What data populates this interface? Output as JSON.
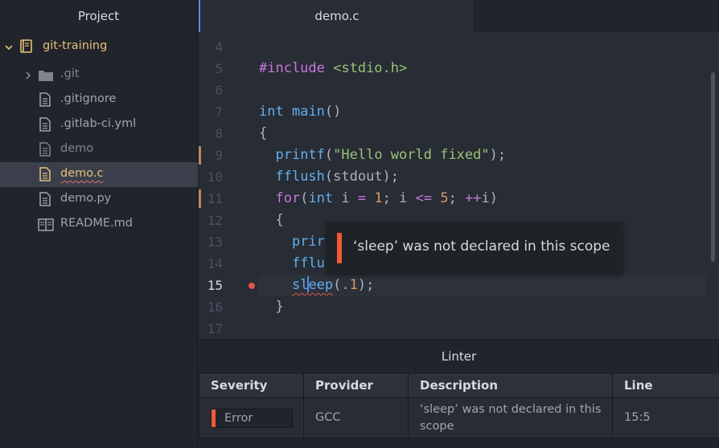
{
  "sidebar": {
    "title": "Project",
    "root": {
      "label": "git-training",
      "icon": "repo-icon"
    },
    "items": [
      {
        "label": ".git",
        "icon": "folder-icon",
        "type": "folder",
        "state": "ignored"
      },
      {
        "label": ".gitignore",
        "icon": "file-icon",
        "type": "file",
        "state": "normal"
      },
      {
        "label": ".gitlab-ci.yml",
        "icon": "file-icon",
        "type": "file",
        "state": "normal"
      },
      {
        "label": "demo",
        "icon": "file-icon",
        "type": "file",
        "state": "ignored"
      },
      {
        "label": "demo.c",
        "icon": "file-icon",
        "type": "file",
        "state": "selected"
      },
      {
        "label": "demo.py",
        "icon": "file-icon",
        "type": "file",
        "state": "normal"
      },
      {
        "label": "README.md",
        "icon": "book-icon",
        "type": "file",
        "state": "normal"
      }
    ]
  },
  "editor": {
    "tab_title": "demo.c",
    "lines": [
      {
        "num": "4",
        "tokens": []
      },
      {
        "num": "5",
        "tokens": [
          [
            "inc",
            "#include "
          ],
          [
            "str",
            "<stdio.h>"
          ]
        ]
      },
      {
        "num": "6",
        "tokens": []
      },
      {
        "num": "7",
        "tokens": [
          [
            "ty",
            "int"
          ],
          [
            "pl",
            " "
          ],
          [
            "fn",
            "main"
          ],
          [
            "pl",
            "()"
          ]
        ]
      },
      {
        "num": "8",
        "tokens": [
          [
            "pl",
            "{"
          ]
        ]
      },
      {
        "num": "9",
        "git": true,
        "tokens": [
          [
            "pl",
            "  "
          ],
          [
            "fn",
            "printf"
          ],
          [
            "pl",
            "("
          ],
          [
            "str",
            "\"Hello world fixed\""
          ],
          [
            "pl",
            ");"
          ]
        ]
      },
      {
        "num": "10",
        "tokens": [
          [
            "pl",
            "  "
          ],
          [
            "fn",
            "fflush"
          ],
          [
            "pl",
            "(stdout);"
          ]
        ]
      },
      {
        "num": "11",
        "git": true,
        "tokens": [
          [
            "pl",
            "  "
          ],
          [
            "kw",
            "for"
          ],
          [
            "pl",
            "("
          ],
          [
            "ty",
            "int"
          ],
          [
            "pl",
            " i "
          ],
          [
            "op",
            "="
          ],
          [
            "pl",
            " "
          ],
          [
            "num",
            "1"
          ],
          [
            "pl",
            "; i "
          ],
          [
            "op",
            "<="
          ],
          [
            "pl",
            " "
          ],
          [
            "num",
            "5"
          ],
          [
            "pl",
            "; "
          ],
          [
            "op",
            "++"
          ],
          [
            "pl",
            "i)"
          ]
        ]
      },
      {
        "num": "12",
        "tokens": [
          [
            "pl",
            "  {"
          ]
        ]
      },
      {
        "num": "13",
        "tokens": [
          [
            "pl",
            "    "
          ],
          [
            "fn",
            "prir"
          ]
        ]
      },
      {
        "num": "14",
        "tokens": [
          [
            "pl",
            "    "
          ],
          [
            "fn",
            "fflu"
          ]
        ]
      },
      {
        "num": "15",
        "active": true,
        "error": true,
        "tokens": [
          [
            "pl",
            "    "
          ],
          [
            "fn",
            "sl"
          ],
          [
            "caret",
            ""
          ],
          [
            "fnerr",
            "eep"
          ],
          [
            "pl",
            "("
          ],
          [
            "num",
            ".1"
          ],
          [
            "pl",
            ");"
          ]
        ]
      },
      {
        "num": "16",
        "tokens": [
          [
            "pl",
            "  }"
          ]
        ]
      },
      {
        "num": "17",
        "tokens": []
      }
    ]
  },
  "tooltip": {
    "message": "‘sleep’ was not declared in this scope"
  },
  "linter": {
    "title": "Linter",
    "columns": [
      "Severity",
      "Provider",
      "Description",
      "Line"
    ],
    "rows": [
      {
        "severity": "Error",
        "provider": "GCC",
        "description": "‘sleep’ was not declared in this scope",
        "line": "15:5"
      }
    ]
  },
  "colors": {
    "error": "#f05a3a",
    "accent": "#528bff",
    "modified": "#e5c07b"
  }
}
